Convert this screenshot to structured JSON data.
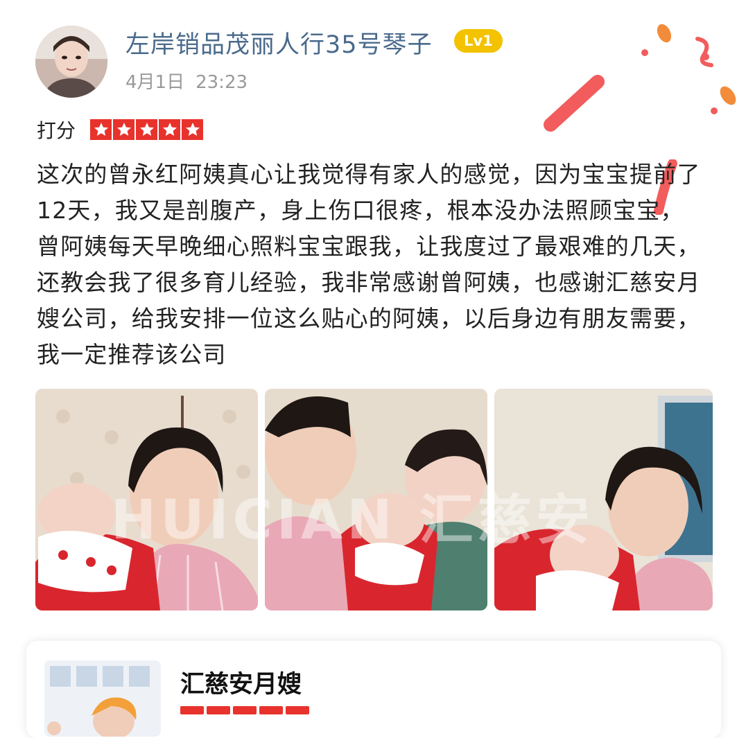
{
  "review": {
    "username": "左岸销品茂丽人行35号琴子",
    "level_badge": "Lv1",
    "date": "4月1日",
    "time": "23:23",
    "rating_label": "打分",
    "rating_stars": 5,
    "text": "这次的曾永红阿姨真心让我觉得有家人的感觉，因为宝宝提前了12天，我又是剖腹产，身上伤口很疼，根本没办法照顾宝宝，曾阿姨每天早晚细心照料宝宝跟我，让我度过了最艰难的几天，还教会我了很多育儿经验，我非常感谢曾阿姨，也感谢汇慈安月嫂公司，给我安排一位这么贴心的阿姨，以后身边有朋友需要，我一定推荐该公司",
    "photos": [
      {
        "icon": "photo-nanny-with-baby"
      },
      {
        "icon": "photo-nanny-mother-baby"
      },
      {
        "icon": "photo-nanny-baby-window"
      }
    ],
    "watermark": "HUICIAN 汇慈安"
  },
  "business_card": {
    "name": "汇慈安月嫂"
  },
  "colors": {
    "username": "#4a6a8c",
    "badge": "#f3c200",
    "star": "#e8322c",
    "timestamp": "#999999"
  }
}
